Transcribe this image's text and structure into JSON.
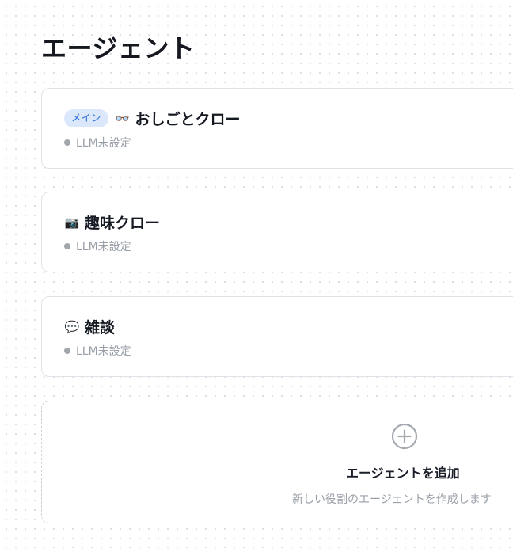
{
  "page": {
    "title": "エージェント"
  },
  "agents": [
    {
      "badge": "メイン",
      "icon": "👓",
      "icon_name": "glasses-icon",
      "name": "おしごとクロー",
      "status": "LLM未設定"
    },
    {
      "icon": "📷",
      "icon_name": "camera-icon",
      "name": "趣味クロー",
      "status": "LLM未設定"
    },
    {
      "icon": "💬",
      "icon_name": "speech-bubble-icon",
      "name": "雑談",
      "status": "LLM未設定"
    }
  ],
  "add_agent": {
    "icon_name": "plus-circle-icon",
    "label": "エージェントを追加",
    "description": "新しい役割のエージェントを作成します"
  },
  "colors": {
    "badge_bg": "#dbe8fb",
    "badge_text": "#2e6fd6",
    "status_dot": "#a2a7ae",
    "muted_text": "#9aa0a8"
  }
}
